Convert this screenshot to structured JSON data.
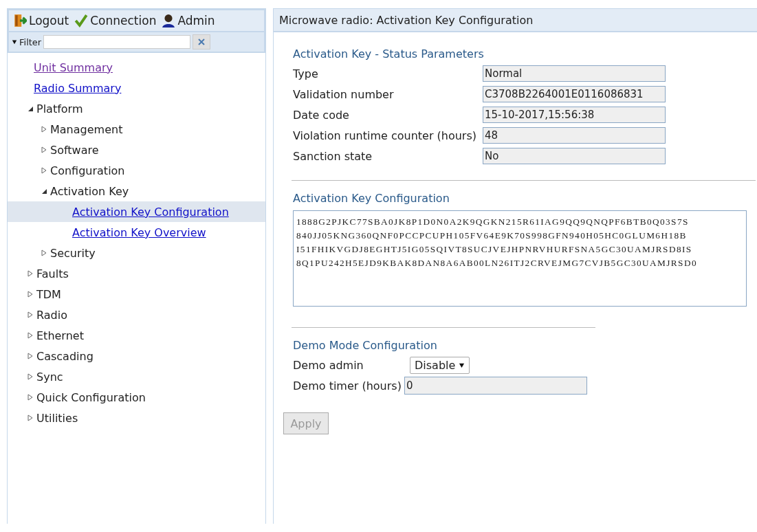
{
  "toolbar": {
    "items": [
      {
        "kind": "logout",
        "label": "Logout"
      },
      {
        "kind": "connection",
        "label": "Connection"
      },
      {
        "kind": "user",
        "label": "Admin"
      }
    ]
  },
  "filter": {
    "label": "Filter"
  },
  "tree": [
    {
      "label": "Unit Summary",
      "kind": "link",
      "visited": true,
      "selected": false
    },
    {
      "label": "Radio Summary",
      "kind": "link",
      "visited": false,
      "selected": false
    },
    {
      "label": "Platform",
      "kind": "node",
      "expanded": true,
      "children": [
        {
          "label": "Management",
          "kind": "node",
          "expanded": false
        },
        {
          "label": "Software",
          "kind": "node",
          "expanded": false
        },
        {
          "label": "Configuration",
          "kind": "node",
          "expanded": false
        },
        {
          "label": "Activation Key",
          "kind": "node",
          "expanded": true,
          "children": [
            {
              "label": "Activation Key Configuration",
              "kind": "link",
              "visited": false,
              "selected": true
            },
            {
              "label": "Activation Key Overview",
              "kind": "link",
              "visited": false,
              "selected": false
            }
          ]
        },
        {
          "label": "Security",
          "kind": "node",
          "expanded": false
        }
      ]
    },
    {
      "label": "Faults",
      "kind": "node",
      "expanded": false
    },
    {
      "label": "TDM",
      "kind": "node",
      "expanded": false
    },
    {
      "label": "Radio",
      "kind": "node",
      "expanded": false
    },
    {
      "label": "Ethernet",
      "kind": "node",
      "expanded": false
    },
    {
      "label": "Cascading",
      "kind": "node",
      "expanded": false
    },
    {
      "label": "Sync",
      "kind": "node",
      "expanded": false
    },
    {
      "label": "Quick Configuration",
      "kind": "node",
      "expanded": false
    },
    {
      "label": "Utilities",
      "kind": "node",
      "expanded": false
    }
  ],
  "page": {
    "title": "Microwave radio: Activation Key Configuration",
    "status": {
      "heading": "Activation Key - Status Parameters",
      "fields": [
        {
          "label": "Type",
          "value": "Normal"
        },
        {
          "label": "Validation number",
          "value": "C3708B2264001E0116086831"
        },
        {
          "label": "Date code",
          "value": "15-10-2017,15:56:38"
        },
        {
          "label": "Violation runtime counter (hours)",
          "value": "48"
        },
        {
          "label": "Sanction state",
          "value": "No"
        }
      ]
    },
    "key_config": {
      "heading": "Activation Key Configuration",
      "key_lines": [
        "1888G2PJKC77SBA0JK8P1D0N0A2K9QGKN215R61IAG9QQ9QNQPF6BTB0Q03S7S",
        "840JJ05KNG360QNF0PCCPCUPH105FV64E9K70S998GFN940H05HC0GLUM6H18B",
        "I51FHIKVGDJ8EGHTJ5IG05SQIVT8SUCJVEJHPNRVHURFSNA5GC30UAMJRSD8IS",
        "8Q1PU242H5EJD9KBAK8DAN8A6AB00LN26ITJ2CRVEJMG7CVJB5GC30UAMJRSD0"
      ]
    },
    "demo": {
      "heading": "Demo Mode Configuration",
      "admin_label": "Demo admin",
      "admin_value": "Disable",
      "timer_label": "Demo timer (hours)",
      "timer_value": "0"
    },
    "apply": {
      "label": "Apply",
      "disabled": true
    }
  }
}
